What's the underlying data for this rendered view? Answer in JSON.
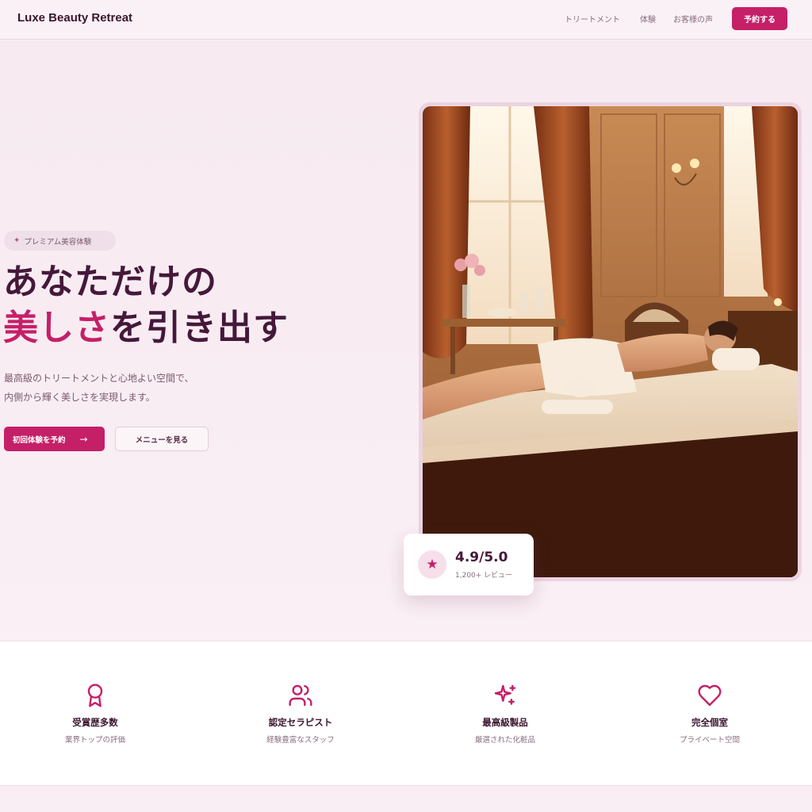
{
  "header": {
    "brand": "Luxe Beauty Retreat",
    "nav": [
      "トリートメント",
      "体験",
      "お客様の声"
    ],
    "cta": "予約する"
  },
  "hero": {
    "badge": "プレミアム美容体験",
    "headline_line1": "あなただけの",
    "headline_accent": "美しさ",
    "headline_rest": "を引き出す",
    "desc_line1": "最高級のトリートメントと心地よい空間で、",
    "desc_line2": "内側から輝く美しさを実現します。",
    "primary_button": "初回体験を予約",
    "secondary_button": "メニューを見る"
  },
  "rating": {
    "value": "4.9/5.0",
    "count": "1,200+ レビュー"
  },
  "features": [
    {
      "icon": "award-icon",
      "title": "受賞歴多数",
      "sub": "業界トップの評価"
    },
    {
      "icon": "users-icon",
      "title": "認定セラピスト",
      "sub": "経験豊富なスタッフ"
    },
    {
      "icon": "sparkles-icon",
      "title": "最高級製品",
      "sub": "厳選された化粧品"
    },
    {
      "icon": "heart-icon",
      "title": "完全個室",
      "sub": "プライベート空間"
    }
  ],
  "colors": {
    "accent": "#c51f68",
    "heading": "#45183a",
    "background": "#f8eef4"
  }
}
